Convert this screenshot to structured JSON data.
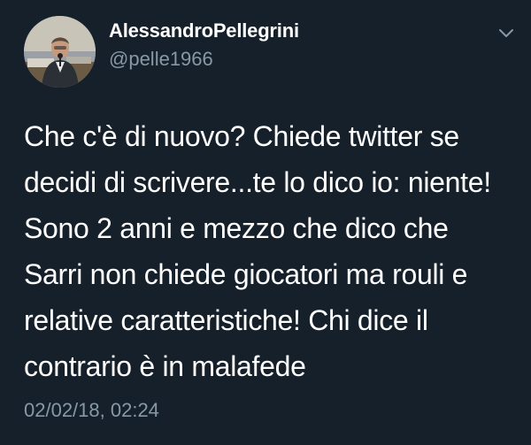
{
  "user": {
    "display_name": "AlessandroPellegrini",
    "handle": "@pelle1966",
    "avatar_icon": "profile-photo"
  },
  "tweet": {
    "text": "Che c'è di nuovo? Chiede twitter se\ndecidi di scrivere...te lo dico io: niente!\nSono 2 anni e mezzo che dico che\nSarri non chiede giocatori ma rouli e\nrelative caratteristiche! Chi dice il\ncontrario è in malafede",
    "timestamp": "02/02/18, 02:24"
  },
  "menu": {
    "icon": "chevron-down-icon"
  },
  "colors": {
    "background": "#15202b",
    "text": "#ffffff",
    "secondary_text": "#8899a6"
  }
}
